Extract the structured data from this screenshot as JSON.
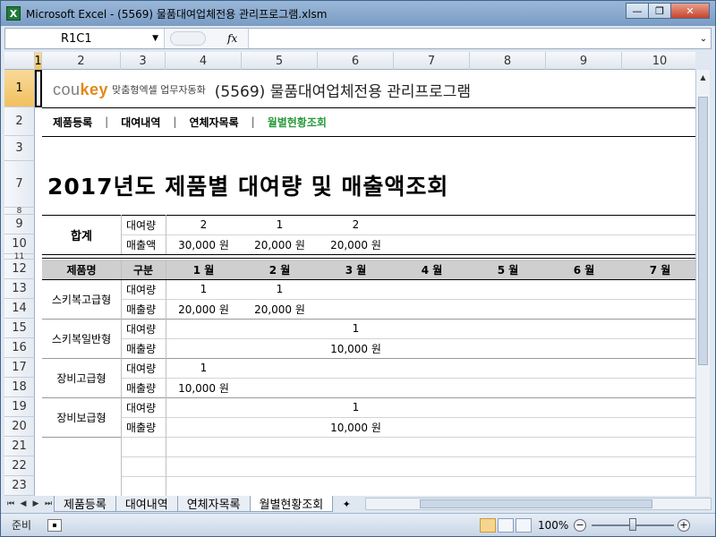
{
  "window": {
    "title": "Microsoft Excel - (5569) 물품대여업체전용 관리프로그램.xlsm",
    "app_icon": "X",
    "buttons": {
      "minimize": "—",
      "restore": "❐",
      "close": "✕"
    }
  },
  "formula_bar": {
    "name_box": "R1C1",
    "fx": "fx",
    "value": ""
  },
  "columns": [
    "1",
    "2",
    "3",
    "4",
    "5",
    "6",
    "7",
    "8",
    "9",
    "10"
  ],
  "selected_column": "1",
  "rows": [
    "1",
    "2",
    "3",
    "7",
    "8",
    "9",
    "10",
    "11",
    "12",
    "13",
    "14",
    "15",
    "16",
    "17",
    "18",
    "19",
    "20",
    "21",
    "22",
    "23"
  ],
  "selected_row": "1",
  "banner": {
    "logo_gray": "cou",
    "logo_orange": "key",
    "logo_sub": "맞춤형엑셀 업무자동화",
    "title": "(5569) 물품대여업체전용 관리프로그램"
  },
  "nav": {
    "items": [
      "제품등록",
      "대여내역",
      "연체자목록",
      "월별현황조회"
    ],
    "separator": "|",
    "active_index": 3,
    "active_color": "#2a9a3c"
  },
  "page_title": "2017년도 제품별 대여량 및 매출액조회",
  "summary": {
    "label": "합계",
    "rows": [
      {
        "kind": "대여량",
        "values": [
          "2",
          "1",
          "2"
        ]
      },
      {
        "kind": "매출액",
        "values": [
          "30,000 원",
          "20,000 원",
          "20,000 원"
        ]
      }
    ]
  },
  "table": {
    "headers": [
      "제품명",
      "구분",
      "1 월",
      "2 월",
      "3 월",
      "4 월",
      "5 월",
      "6 월",
      "7 월"
    ],
    "products": [
      {
        "name": "스키복고급형",
        "rental": [
          "1",
          "1",
          "",
          "",
          "",
          "",
          ""
        ],
        "sales": [
          "20,000 원",
          "20,000 원",
          "",
          "",
          "",
          "",
          ""
        ]
      },
      {
        "name": "스키복일반형",
        "rental": [
          "",
          "",
          "1",
          "",
          "",
          "",
          ""
        ],
        "sales": [
          "",
          "",
          "10,000 원",
          "",
          "",
          "",
          ""
        ]
      },
      {
        "name": "장비고급형",
        "rental": [
          "1",
          "",
          "",
          "",
          "",
          "",
          ""
        ],
        "sales": [
          "10,000 원",
          "",
          "",
          "",
          "",
          "",
          ""
        ]
      },
      {
        "name": "장비보급형",
        "rental": [
          "",
          "",
          "1",
          "",
          "",
          "",
          ""
        ],
        "sales": [
          "",
          "",
          "10,000 원",
          "",
          "",
          "",
          ""
        ]
      }
    ],
    "rental_label": "대여량",
    "sales_label": "매출량"
  },
  "sheet_tabs": [
    "제품등록",
    "대여내역",
    "연체자목록",
    "월별현황조회"
  ],
  "active_sheet_index": 3,
  "status": {
    "mode": "준비",
    "zoom": "100%"
  }
}
